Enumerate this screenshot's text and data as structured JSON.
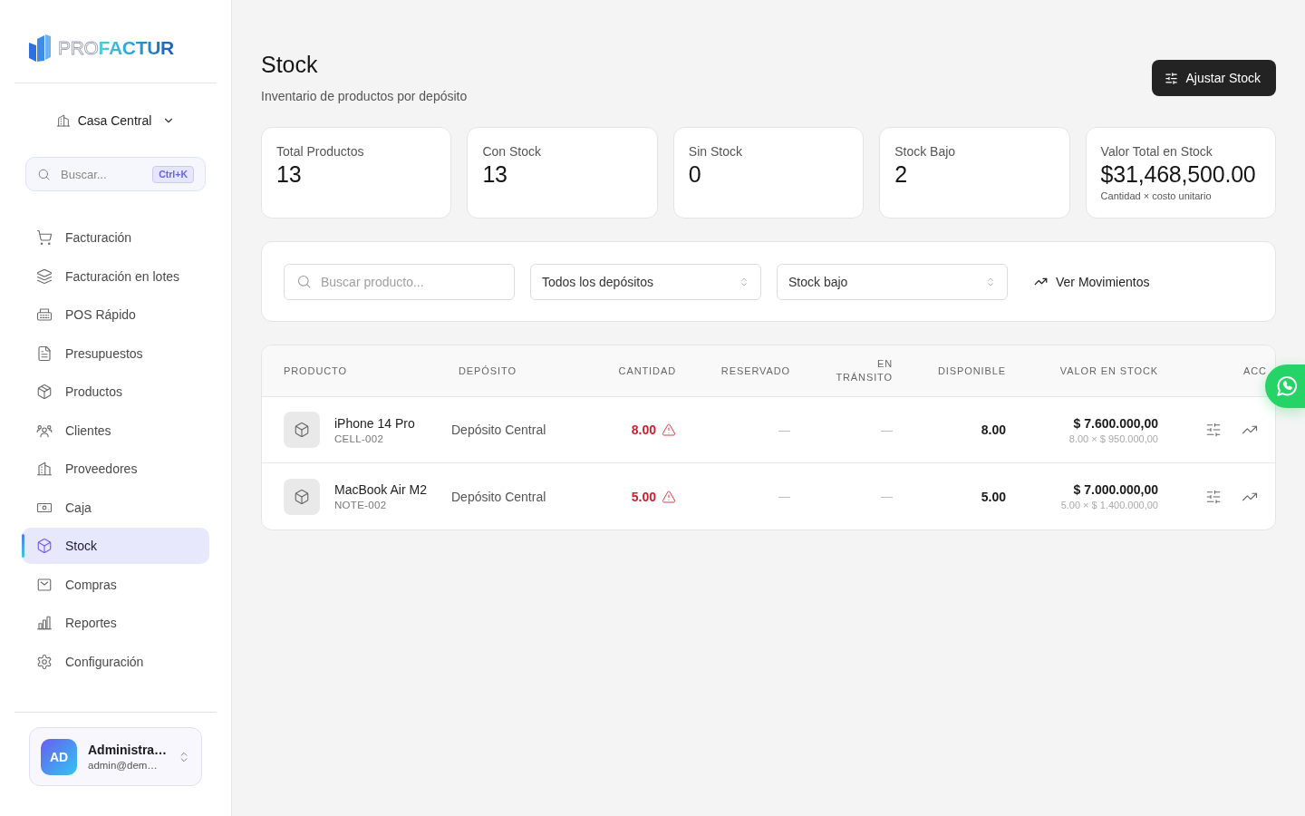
{
  "sidebar": {
    "brand": {
      "outline_part": "PRO",
      "solid_part": "FACTUR"
    },
    "branch": {
      "label": "Casa Central"
    },
    "search": {
      "placeholder": "Buscar...",
      "shortcut": "Ctrl+K"
    },
    "nav": [
      {
        "label": "Facturación",
        "selected": false
      },
      {
        "label": "Facturación en lotes",
        "selected": false
      },
      {
        "label": "POS Rápido",
        "selected": false
      },
      {
        "label": "Presupuestos",
        "selected": false
      },
      {
        "label": "Productos",
        "selected": false
      },
      {
        "label": "Clientes",
        "selected": false
      },
      {
        "label": "Proveedores",
        "selected": false
      },
      {
        "label": "Caja",
        "selected": false
      },
      {
        "label": "Stock",
        "selected": true
      },
      {
        "label": "Compras",
        "selected": false
      },
      {
        "label": "Reportes",
        "selected": false
      },
      {
        "label": "Configuración",
        "selected": false
      }
    ],
    "user": {
      "initials": "AD",
      "name": "Administra…",
      "email": "admin@dem…"
    }
  },
  "header": {
    "title": "Stock",
    "subtitle": "Inventario de productos por depósito",
    "action": "Ajustar Stock"
  },
  "stats": [
    {
      "label": "Total Productos",
      "value": "13"
    },
    {
      "label": "Con Stock",
      "value": "13"
    },
    {
      "label": "Sin Stock",
      "value": "0"
    },
    {
      "label": "Stock Bajo",
      "value": "2"
    },
    {
      "label": "Valor Total en Stock",
      "value": "$31,468,500.00",
      "note": "Cantidad × costo unitario"
    }
  ],
  "filters": {
    "search": {
      "placeholder": "Buscar producto..."
    },
    "selects": [
      {
        "value": "Todos los depósitos"
      },
      {
        "value": "Stock bajo"
      }
    ],
    "link": "Ver Movimientos"
  },
  "table": {
    "columns": [
      "PRODUCTO",
      "DEPÓSITO",
      "CANTIDAD",
      "RESERVADO",
      "EN TRÁNSITO",
      "DISPONIBLE",
      "VALOR EN STOCK",
      "ACC"
    ],
    "rows": [
      {
        "name": "iPhone 14 Pro",
        "sku": "CELL-002",
        "deposit": "Depósito Central",
        "quantity": "8.00",
        "low_stock": true,
        "reserved": "—",
        "in_transit": "—",
        "available": "8.00",
        "value": "$ 7.600.000,00",
        "value_detail": "8.00 × $ 950.000,00"
      },
      {
        "name": "MacBook Air M2",
        "sku": "NOTE-002",
        "deposit": "Depósito Central",
        "quantity": "5.00",
        "low_stock": true,
        "reserved": "—",
        "in_transit": "—",
        "available": "5.00",
        "value": "$ 7.000.000,00",
        "value_detail": "5.00 × $ 1.400.000,00"
      }
    ]
  }
}
